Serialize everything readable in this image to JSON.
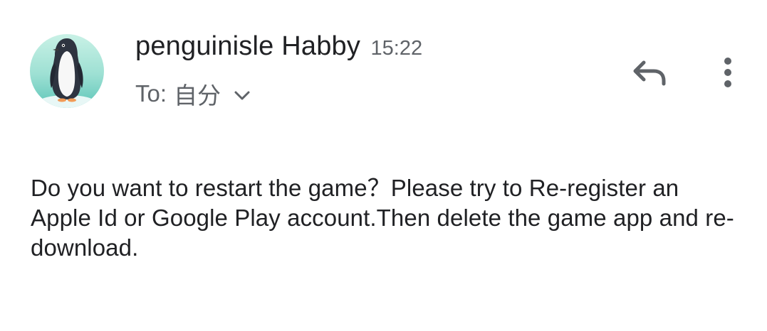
{
  "sender": {
    "name": "penguinisle Habby",
    "time": "15:22"
  },
  "recipient": {
    "label": "To:",
    "value": "自分"
  },
  "icons": {
    "avatar": "penguin-avatar",
    "expand": "chevron-down-icon",
    "reply": "reply-icon",
    "more": "more-vert-icon"
  },
  "colors": {
    "primary_text": "#202124",
    "secondary_text": "#5f6368",
    "icon": "#5f6368",
    "avatar_background": "#8fd9cf"
  },
  "message": {
    "body": "Do you want to restart the game？Please try to Re-register an Apple Id or Google Play account.Then delete the game app and re-download."
  }
}
